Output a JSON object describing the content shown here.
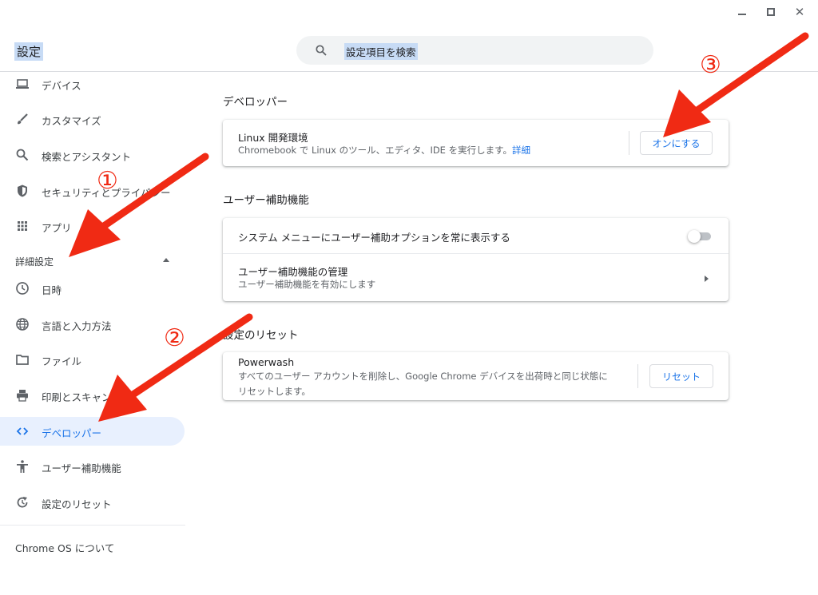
{
  "window": {
    "title": "設定"
  },
  "search": {
    "placeholder": "設定項目を検索"
  },
  "sidebar": {
    "items_top": [
      {
        "label": "デバイス",
        "icon": "laptop-icon"
      },
      {
        "label": "カスタマイズ",
        "icon": "brush-icon"
      },
      {
        "label": "検索とアシスタント",
        "icon": "search-icon"
      },
      {
        "label": "セキュリティとプライバシー",
        "icon": "shield-icon"
      },
      {
        "label": "アプリ",
        "icon": "apps-grid-icon"
      }
    ],
    "advanced_header": "詳細設定",
    "items_advanced": [
      {
        "label": "日時",
        "icon": "clock-icon"
      },
      {
        "label": "言語と入力方法",
        "icon": "globe-icon"
      },
      {
        "label": "ファイル",
        "icon": "folder-icon"
      },
      {
        "label": "印刷とスキャン",
        "icon": "printer-icon"
      },
      {
        "label": "デベロッパー",
        "icon": "code-icon",
        "active": true
      },
      {
        "label": "ユーザー補助機能",
        "icon": "accessibility-icon"
      },
      {
        "label": "設定のリセット",
        "icon": "reset-icon"
      }
    ],
    "about": "Chrome OS について"
  },
  "developer": {
    "section_title": "デベロッパー",
    "linux_title": "Linux 開発環境",
    "linux_sub": "Chromebook で Linux のツール、エディタ、IDE を実行します。",
    "linux_link": "詳細",
    "linux_button": "オンにする"
  },
  "accessibility": {
    "section_title": "ユーザー補助機能",
    "menu_option": "システム メニューにユーザー補助オプションを常に表示する",
    "menu_option_on": false,
    "manage_title": "ユーザー補助機能の管理",
    "manage_sub": "ユーザー補助機能を有効にします"
  },
  "reset": {
    "section_title": "設定のリセット",
    "powerwash_title": "Powerwash",
    "powerwash_sub1": "すべてのユーザー アカウントを削除し、Google Chrome デバイスを出荷時と同じ状態に",
    "powerwash_sub2": "リセットします。",
    "reset_button": "リセット"
  },
  "annotations": {
    "step1": "①",
    "step2": "②",
    "step3": "③",
    "arrow_color": "#f02a14"
  },
  "colors": {
    "accent": "#1a73e8",
    "active_bg": "#e8f0fe",
    "search_bg": "#f1f3f4"
  }
}
